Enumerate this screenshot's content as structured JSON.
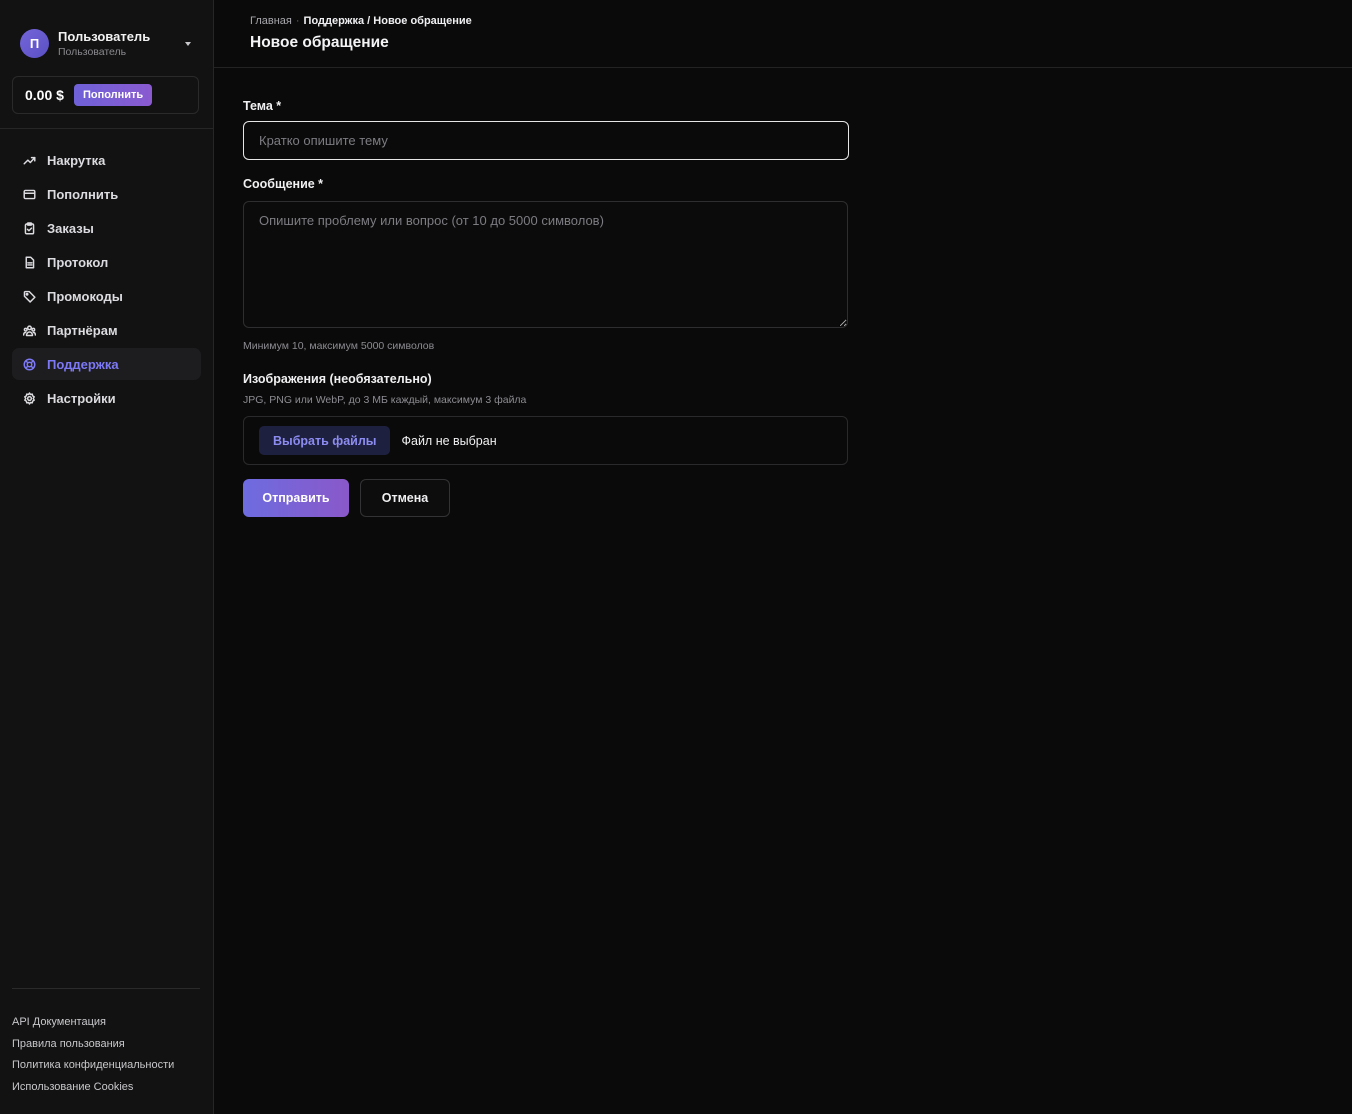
{
  "user": {
    "avatar_letter": "П",
    "name": "Пользователь",
    "role": "Пользователь"
  },
  "balance": {
    "amount": "0.00 $",
    "topup_label": "Пополнить"
  },
  "sidebar": {
    "items": [
      {
        "label": "Накрутка",
        "icon": "trend-up-icon"
      },
      {
        "label": "Пополнить",
        "icon": "credit-card-icon"
      },
      {
        "label": "Заказы",
        "icon": "clipboard-icon"
      },
      {
        "label": "Протокол",
        "icon": "document-icon"
      },
      {
        "label": "Промокоды",
        "icon": "tag-icon"
      },
      {
        "label": "Партнёрам",
        "icon": "users-icon"
      },
      {
        "label": "Поддержка",
        "icon": "lifebuoy-icon",
        "active": true
      },
      {
        "label": "Настройки",
        "icon": "gear-icon"
      }
    ],
    "active_color": "#7d78f5"
  },
  "footer": {
    "links": [
      "API Документация",
      "Правила пользования",
      "Политика конфиденциальности",
      "Использование Cookies"
    ]
  },
  "header": {
    "breadcrumb": {
      "home": "Главная",
      "separator": "·",
      "current": "Поддержка / Новое обращение"
    },
    "title": "Новое обращение"
  },
  "form": {
    "subject": {
      "label": "Тема *",
      "placeholder": "Кратко опишите тему",
      "value": ""
    },
    "message": {
      "label": "Сообщение *",
      "placeholder": "Опишите проблему или вопрос (от 10 до 5000 символов)",
      "value": "",
      "hint": "Минимум 10, максимум 5000 символов"
    },
    "images": {
      "label": "Изображения (необязательно)",
      "hint": "JPG, PNG или WebP, до 3 МБ каждый, максимум 3 файла",
      "choose_label": "Выбрать файлы",
      "status": "Файл не выбран"
    },
    "submit_label": "Отправить",
    "cancel_label": "Отмена"
  },
  "colors": {
    "accent": "#6f61d8",
    "background": "#0a0a0a",
    "sidebar": "#121212"
  }
}
